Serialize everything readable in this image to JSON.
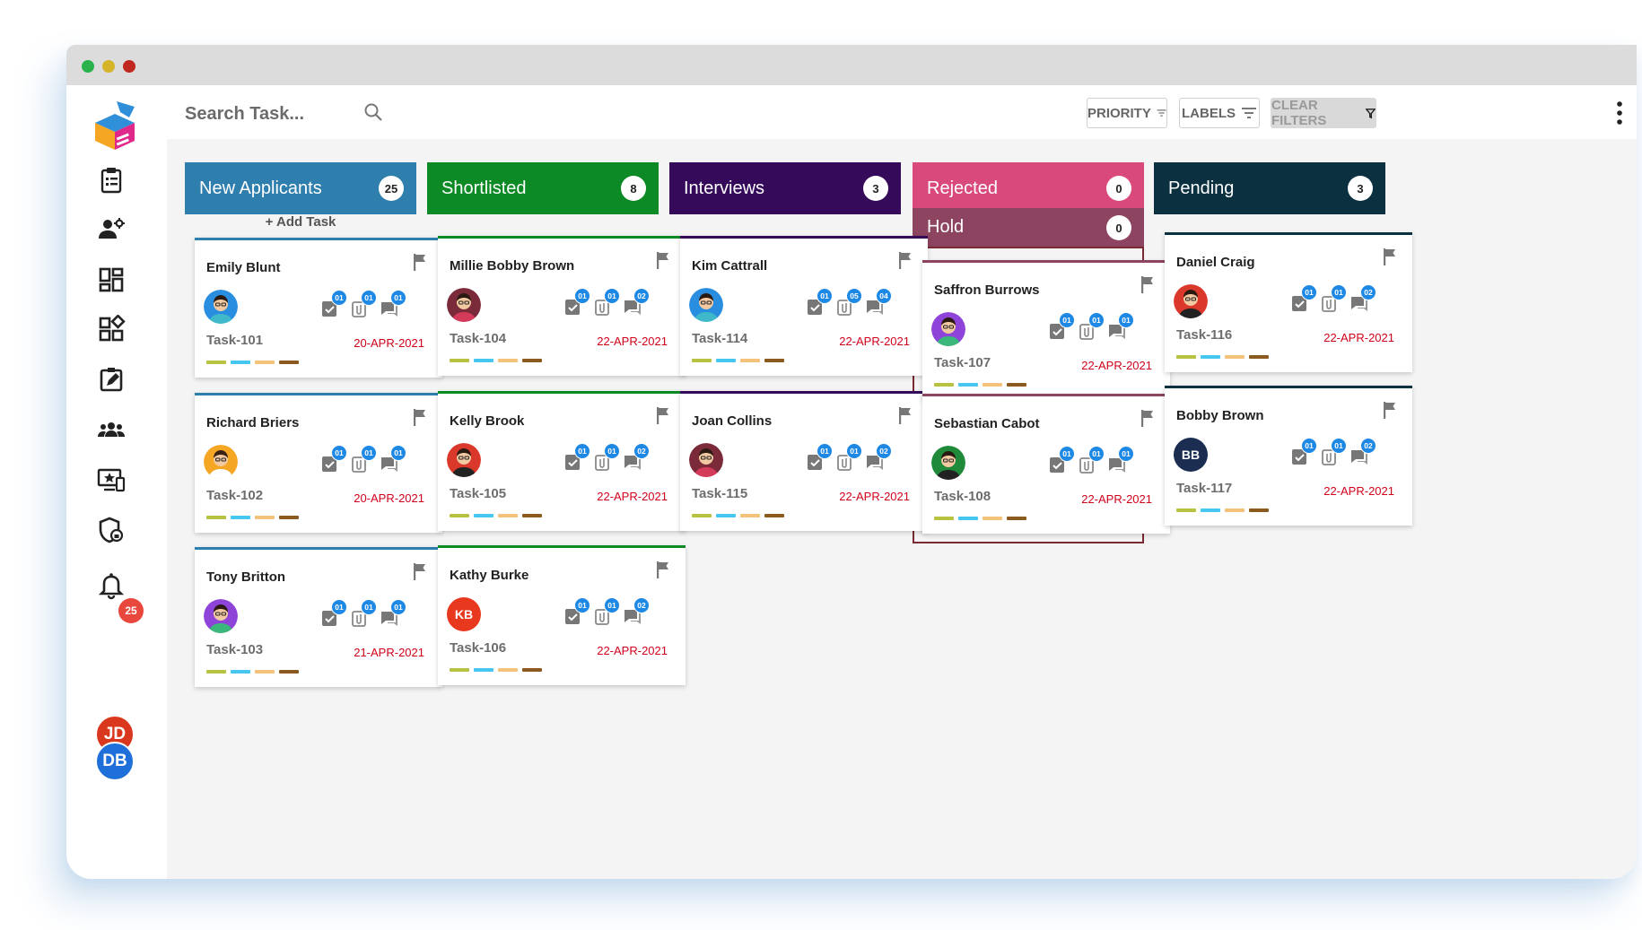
{
  "app": {
    "notification_count": "25"
  },
  "search": {
    "placeholder": "Search Task..."
  },
  "filters": {
    "priority": "PRIORITY",
    "labels": "LABELS",
    "clear": "CLEAR FILTERS"
  },
  "users": [
    {
      "initials": "JD",
      "color": "#d9381e"
    },
    {
      "initials": "DB",
      "color": "#1e6fd9"
    }
  ],
  "label_colors": [
    "#b7c240",
    "#45c7f0",
    "#f4c27a",
    "#8b5a1f"
  ],
  "columns": [
    {
      "title": "New Applicants",
      "count": "25",
      "color": "#2f7fae",
      "add_task": "+ Add Task"
    },
    {
      "title": "Shortlisted",
      "count": "8",
      "color": "#0c8a25"
    },
    {
      "title": "Interviews",
      "count": "3",
      "color": "#350a5a"
    },
    {
      "title": "Rejected",
      "count": "0",
      "color": "#d9497c"
    },
    {
      "title": "Pending",
      "count": "3",
      "color": "#0b3040"
    }
  ],
  "hold": {
    "title": "Hold",
    "count": "0",
    "color": "#8d4460"
  },
  "cards": [
    {
      "name": "Emily Blunt",
      "task": "Task-101",
      "date": "20-APR-2021",
      "avatar": "face-blue",
      "counts": [
        "01",
        "01",
        "01"
      ]
    },
    {
      "name": "Richard Briers",
      "task": "Task-102",
      "date": "20-APR-2021",
      "avatar": "face-orange",
      "counts": [
        "01",
        "01",
        "01"
      ]
    },
    {
      "name": "Tony Britton",
      "task": "Task-103",
      "date": "21-APR-2021",
      "avatar": "face-purple",
      "counts": [
        "01",
        "01",
        "01"
      ]
    },
    {
      "name": "Millie Bobby Brown",
      "task": "Task-104",
      "date": "22-APR-2021",
      "avatar": "face-maroon",
      "counts": [
        "01",
        "01",
        "02"
      ]
    },
    {
      "name": "Kelly Brook",
      "task": "Task-105",
      "date": "22-APR-2021",
      "avatar": "face-red",
      "counts": [
        "01",
        "01",
        "02"
      ]
    },
    {
      "name": "Kathy Burke",
      "task": "Task-106",
      "date": "22-APR-2021",
      "avatar": "initials",
      "initials": "KB",
      "counts": [
        "01",
        "01",
        "02"
      ]
    },
    {
      "name": "Kim Cattrall",
      "task": "Task-114",
      "date": "22-APR-2021",
      "avatar": "face-blue",
      "counts": [
        "01",
        "05",
        "04"
      ]
    },
    {
      "name": "Joan Collins",
      "task": "Task-115",
      "date": "22-APR-2021",
      "avatar": "face-maroon",
      "counts": [
        "01",
        "01",
        "02"
      ]
    },
    {
      "name": "Saffron Burrows",
      "task": "Task-107",
      "date": "22-APR-2021",
      "avatar": "face-purple",
      "counts": [
        "01",
        "01",
        "01"
      ]
    },
    {
      "name": "Sebastian Cabot",
      "task": "Task-108",
      "date": "22-APR-2021",
      "avatar": "face-green",
      "counts": [
        "01",
        "01",
        "01"
      ]
    },
    {
      "name": "Daniel Craig",
      "task": "Task-116",
      "date": "22-APR-2021",
      "avatar": "face-red",
      "counts": [
        "01",
        "01",
        "02"
      ]
    },
    {
      "name": "Bobby Brown",
      "task": "Task-117",
      "date": "22-APR-2021",
      "avatar": "initials",
      "initials": "BB",
      "counts": [
        "01",
        "01",
        "02"
      ]
    }
  ]
}
